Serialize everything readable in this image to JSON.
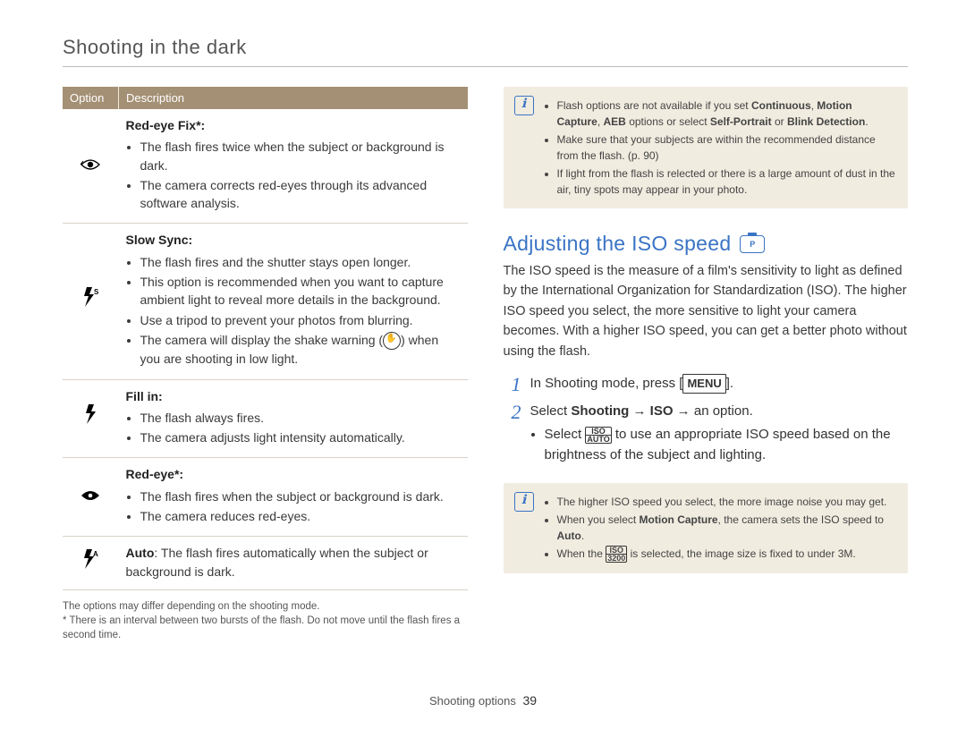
{
  "section_title": "Shooting in the dark",
  "table": {
    "headers": [
      "Option",
      "Description"
    ],
    "rows": [
      {
        "icon_name": "redeye-fix-icon",
        "icon_svg": "eye",
        "title": "Red-eye Fix*:",
        "bullets": [
          "The flash fires twice when the subject or background is dark.",
          "The camera corrects red-eyes through its advanced software analysis."
        ]
      },
      {
        "icon_name": "slow-sync-icon",
        "icon_svg": "boltS",
        "title": "Slow Sync:",
        "bullets": [
          "The flash fires and the shutter stays open longer.",
          "This option is recommended when you want to capture ambient light to reveal more details in the background.",
          "Use a tripod to prevent your photos from blurring.",
          "The camera will display the shake warning (  ) when you are shooting in low light."
        ]
      },
      {
        "icon_name": "fill-in-icon",
        "icon_svg": "bolt",
        "title": "Fill in:",
        "bullets": [
          "The flash always fires.",
          "The camera adjusts light intensity automatically."
        ]
      },
      {
        "icon_name": "red-eye-icon",
        "icon_svg": "eye-solid",
        "title": "Red-eye*:",
        "bullets": [
          "The flash fires when the subject or background is dark.",
          "The camera reduces red-eyes."
        ]
      },
      {
        "icon_name": "auto-flash-icon",
        "icon_svg": "boltA",
        "title": "Auto",
        "inline": ": The flash fires automatically when the subject or background is dark."
      }
    ]
  },
  "fine_print": [
    "The options may differ depending on the shooting mode.",
    "* There is an interval between two bursts of the flash. Do not move until the flash fires a second time."
  ],
  "note1": {
    "items_html": [
      "Flash options are not available if you set <b>Continuous</b>, <b>Motion Capture</b>, <b>AEB</b> options or select <b>Self-Portrait</b> or <b>Blink Detection</b>.",
      "Make sure that your subjects are within the recommended distance from the flash. (p. 90)",
      "If light from the flash is relected or there is a large amount of dust in the air, tiny spots may appear in your photo."
    ]
  },
  "iso_heading": "Adjusting the ISO speed",
  "iso_badge": "P",
  "iso_desc": "The ISO speed is the measure of a film's sensitivity to light as defined by the International Organization for Standardization (ISO). The higher ISO speed you select, the more sensitive to light your camera becomes. With a higher ISO speed, you can get a better photo without using the flash.",
  "steps": [
    {
      "num": "1",
      "pre": "In Shooting mode, press [",
      "btn": "MENU",
      "post": "]."
    },
    {
      "num": "2",
      "pre": "Select ",
      "bold": "Shooting → ISO",
      "post": " → an option.",
      "sub_pre": "Select ",
      "sub_iso_top": "ISO",
      "sub_iso_bot": "AUTO",
      "sub_post": " to use an appropriate ISO speed based on the brightness of the subject and lighting."
    }
  ],
  "note2": {
    "items": [
      {
        "text": "The higher ISO speed you select, the more image noise you may get."
      },
      {
        "pre": "When you select ",
        "bold": "Motion Capture",
        "mid": ", the camera sets the ISO speed to ",
        "bold2": "Auto",
        "post": "."
      },
      {
        "pre": "When the ",
        "iso_top": "ISO",
        "iso_bot": "3200",
        "post": " is selected, the image size is fixed to under 3M."
      }
    ]
  },
  "footer": {
    "label": "Shooting options",
    "page": "39"
  }
}
